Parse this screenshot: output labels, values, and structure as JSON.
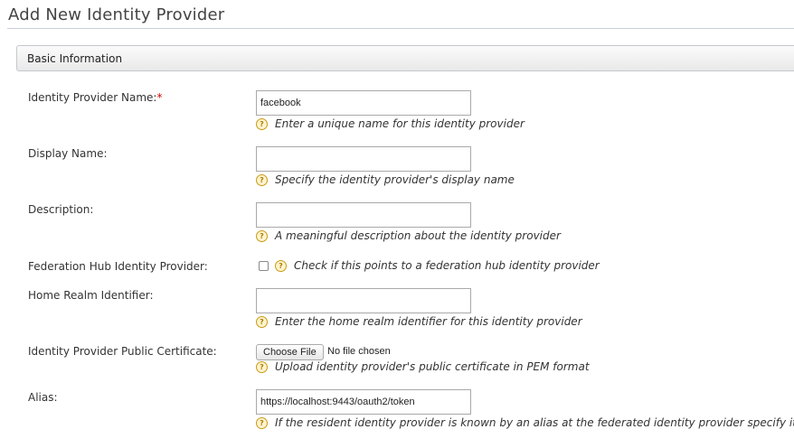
{
  "page": {
    "title": "Add New Identity Provider"
  },
  "section": {
    "title": "Basic Information"
  },
  "fields": {
    "idp_name": {
      "label": "Identity Provider Name:",
      "required_mark": "*",
      "value": "facebook",
      "help": "Enter a unique name for this identity provider"
    },
    "display_name": {
      "label": "Display Name:",
      "value": "",
      "help": "Specify the identity provider's display name"
    },
    "description": {
      "label": "Description:",
      "value": "",
      "help": "A meaningful description about the identity provider"
    },
    "federation_hub": {
      "label": "Federation Hub Identity Provider:",
      "checked": false,
      "help": "Check if this points to a federation hub identity provider"
    },
    "home_realm": {
      "label": "Home Realm Identifier:",
      "value": "",
      "help": "Enter the home realm identifier for this identity provider"
    },
    "certificate": {
      "label": "Identity Provider Public Certificate:",
      "button_label": "Choose File",
      "status": "No file chosen",
      "help": "Upload identity provider's public certificate in PEM format"
    },
    "alias": {
      "label": "Alias:",
      "value": "https://localhost:9443/oauth2/token",
      "help": "If the resident identity provider is known by an alias at the federated identity provider specify it"
    }
  },
  "icons": {
    "help": "question-circle-icon"
  },
  "colors": {
    "required": "#dd0000",
    "help_icon": "#c99a14"
  }
}
